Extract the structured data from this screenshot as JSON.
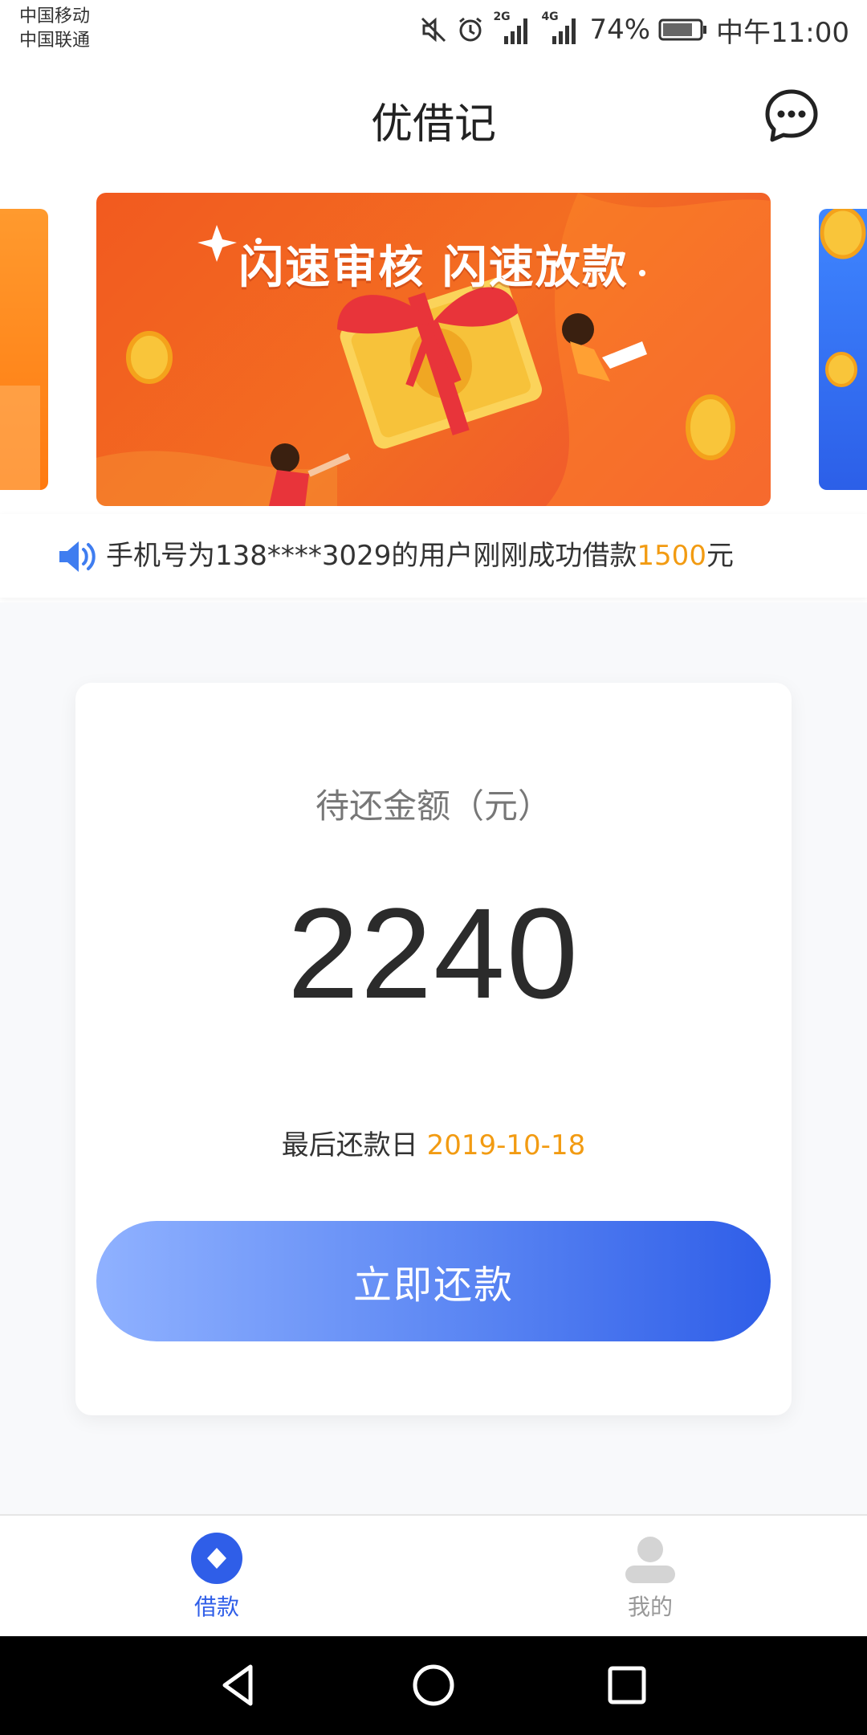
{
  "status_bar": {
    "carrier_1": "中国移动",
    "carrier_2": "中国联通",
    "network_1": "2G",
    "network_2": "4G",
    "battery": "74%",
    "time": "中午11:00"
  },
  "header": {
    "title": "优借记",
    "message_icon": "chat-bubble-icon"
  },
  "banner": {
    "headline": "闪速审核 闪速放款"
  },
  "notice": {
    "icon": "speaker-icon",
    "prefix": "手机号为138****3029的用户刚刚成功借款",
    "amount": "1500",
    "suffix": "元"
  },
  "card": {
    "label": "待还金额（元）",
    "amount": "2240",
    "due_label": "最后还款日 ",
    "due_date": "2019-10-18",
    "button_label": "立即还款"
  },
  "tabbar": {
    "tabs": [
      {
        "label": "借款",
        "icon": "loan-diamond-icon",
        "active": true
      },
      {
        "label": "我的",
        "icon": "user-profile-icon",
        "active": false
      }
    ]
  },
  "colors": {
    "accent": "#2f5ee8",
    "highlight": "#f29b12",
    "banner": "#f25a1f"
  }
}
